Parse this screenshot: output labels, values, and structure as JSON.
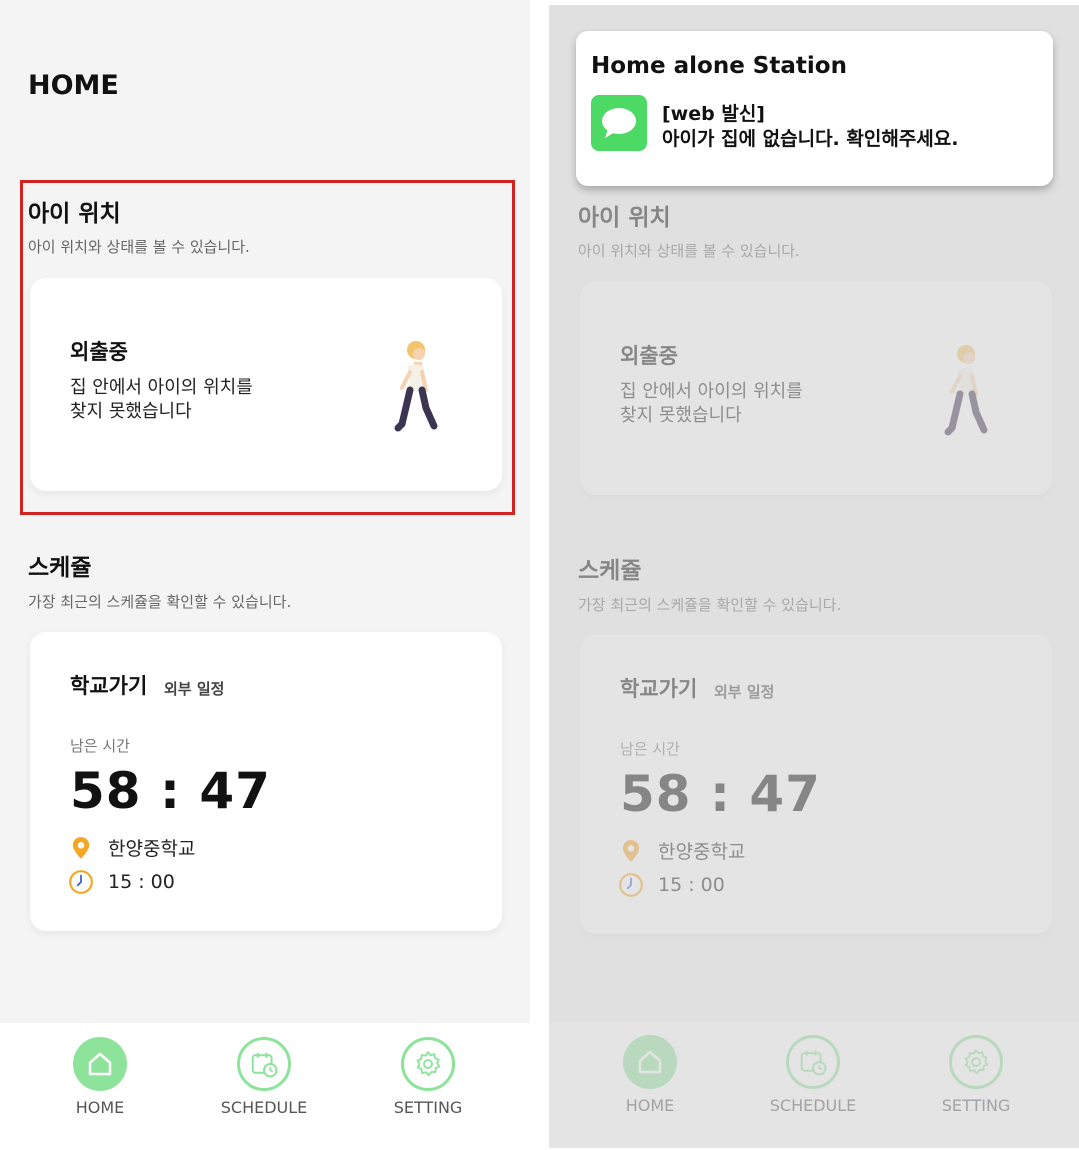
{
  "home": {
    "title": "HOME",
    "location_section": {
      "title": "아이 위치",
      "subtitle": "아이 위치와 상태를 볼 수 있습니다.",
      "status_title": "외출중",
      "status_desc_line1": "집 안에서 아이의 위치를",
      "status_desc_line2": "찾지 못했습니다"
    },
    "schedule_section": {
      "title": "스케쥴",
      "subtitle": "가장 최근의 스케쥴을 확인할 수 있습니다.",
      "schedule_title": "학교가기",
      "schedule_tag": "외부 일정",
      "remain_label": "남은 시간",
      "remain_time": "58 : 47",
      "place": "한양중학교",
      "time": "15 : 00"
    }
  },
  "nav": {
    "items": [
      {
        "label": "HOME",
        "icon": "home-icon",
        "active": true
      },
      {
        "label": "SCHEDULE",
        "icon": "calendar-clock-icon",
        "active": false
      },
      {
        "label": "SETTING",
        "icon": "gear-icon",
        "active": false
      }
    ]
  },
  "notification": {
    "app_name": "Home alone Station",
    "icon": "message-bubble-icon",
    "header": "[web 발신]",
    "body": "아이가 집에 없습니다. 확인해주세요."
  },
  "colors": {
    "accent_green": "#8de39a",
    "highlight_red": "#d32222",
    "pin_orange": "#f5a623",
    "message_green": "#4cd964"
  }
}
